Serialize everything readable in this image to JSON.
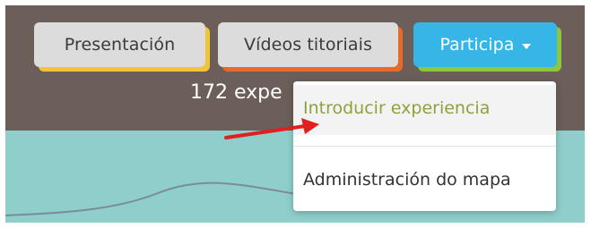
{
  "nav": {
    "items": [
      {
        "label": "Presentación"
      },
      {
        "label": "Vídeos titoriais"
      },
      {
        "label": "Participa"
      }
    ]
  },
  "header": {
    "experiences_text": "172 expe"
  },
  "dropdown": {
    "items": [
      {
        "label": "Introducir experiencia"
      },
      {
        "label": "Administración do mapa"
      }
    ]
  },
  "colors": {
    "header_bg": "#6c5e58",
    "map_bg": "#8fcfcb",
    "participa_bg": "#36b6e6",
    "accent_yellow": "#f2c43a",
    "accent_orange": "#e86a2a",
    "accent_green": "#8ec63f",
    "highlight_text": "#8ca23a",
    "annotation_arrow": "#e02020"
  },
  "icons": {
    "participa_caret": "chevron-down-icon",
    "annotation": "red-arrow-icon"
  }
}
